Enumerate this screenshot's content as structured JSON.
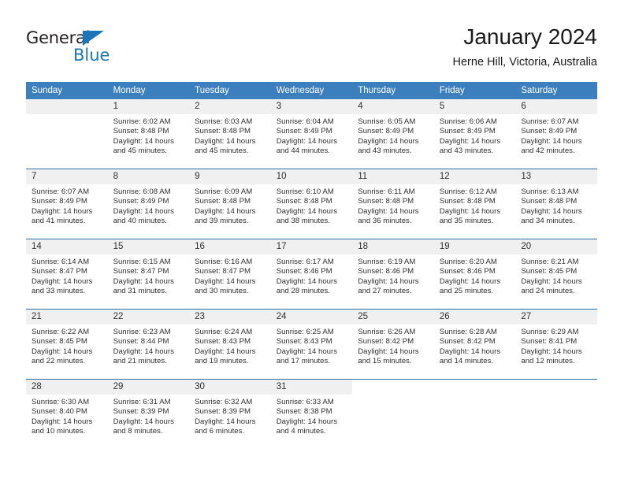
{
  "logo": {
    "word_one": "General",
    "word_two": "Blue",
    "triangle_color": "#1b75bb",
    "text_color": "#231f20"
  },
  "header": {
    "title": "January 2024",
    "subtitle": "Herne Hill, Victoria, Australia"
  },
  "theme": {
    "header_blue": "#3c7fbf",
    "row_border_blue": "#2e6da4",
    "daynum_background": "#f0f0f0",
    "text_color": "#303030"
  },
  "weekday_headers": [
    "Sunday",
    "Monday",
    "Tuesday",
    "Wednesday",
    "Thursday",
    "Friday",
    "Saturday"
  ],
  "weeks": [
    [
      {
        "day": "",
        "sunrise": "",
        "sunset": "",
        "daylight_line1": "",
        "daylight_line2": "",
        "blank": true
      },
      {
        "day": "1",
        "sunrise": "Sunrise: 6:02 AM",
        "sunset": "Sunset: 8:48 PM",
        "daylight_line1": "Daylight: 14 hours",
        "daylight_line2": "and 45 minutes."
      },
      {
        "day": "2",
        "sunrise": "Sunrise: 6:03 AM",
        "sunset": "Sunset: 8:48 PM",
        "daylight_line1": "Daylight: 14 hours",
        "daylight_line2": "and 45 minutes."
      },
      {
        "day": "3",
        "sunrise": "Sunrise: 6:04 AM",
        "sunset": "Sunset: 8:49 PM",
        "daylight_line1": "Daylight: 14 hours",
        "daylight_line2": "and 44 minutes."
      },
      {
        "day": "4",
        "sunrise": "Sunrise: 6:05 AM",
        "sunset": "Sunset: 8:49 PM",
        "daylight_line1": "Daylight: 14 hours",
        "daylight_line2": "and 43 minutes."
      },
      {
        "day": "5",
        "sunrise": "Sunrise: 6:06 AM",
        "sunset": "Sunset: 8:49 PM",
        "daylight_line1": "Daylight: 14 hours",
        "daylight_line2": "and 43 minutes."
      },
      {
        "day": "6",
        "sunrise": "Sunrise: 6:07 AM",
        "sunset": "Sunset: 8:49 PM",
        "daylight_line1": "Daylight: 14 hours",
        "daylight_line2": "and 42 minutes."
      }
    ],
    [
      {
        "day": "7",
        "sunrise": "Sunrise: 6:07 AM",
        "sunset": "Sunset: 8:49 PM",
        "daylight_line1": "Daylight: 14 hours",
        "daylight_line2": "and 41 minutes."
      },
      {
        "day": "8",
        "sunrise": "Sunrise: 6:08 AM",
        "sunset": "Sunset: 8:49 PM",
        "daylight_line1": "Daylight: 14 hours",
        "daylight_line2": "and 40 minutes."
      },
      {
        "day": "9",
        "sunrise": "Sunrise: 6:09 AM",
        "sunset": "Sunset: 8:48 PM",
        "daylight_line1": "Daylight: 14 hours",
        "daylight_line2": "and 39 minutes."
      },
      {
        "day": "10",
        "sunrise": "Sunrise: 6:10 AM",
        "sunset": "Sunset: 8:48 PM",
        "daylight_line1": "Daylight: 14 hours",
        "daylight_line2": "and 38 minutes."
      },
      {
        "day": "11",
        "sunrise": "Sunrise: 6:11 AM",
        "sunset": "Sunset: 8:48 PM",
        "daylight_line1": "Daylight: 14 hours",
        "daylight_line2": "and 36 minutes."
      },
      {
        "day": "12",
        "sunrise": "Sunrise: 6:12 AM",
        "sunset": "Sunset: 8:48 PM",
        "daylight_line1": "Daylight: 14 hours",
        "daylight_line2": "and 35 minutes."
      },
      {
        "day": "13",
        "sunrise": "Sunrise: 6:13 AM",
        "sunset": "Sunset: 8:48 PM",
        "daylight_line1": "Daylight: 14 hours",
        "daylight_line2": "and 34 minutes."
      }
    ],
    [
      {
        "day": "14",
        "sunrise": "Sunrise: 6:14 AM",
        "sunset": "Sunset: 8:47 PM",
        "daylight_line1": "Daylight: 14 hours",
        "daylight_line2": "and 33 minutes."
      },
      {
        "day": "15",
        "sunrise": "Sunrise: 6:15 AM",
        "sunset": "Sunset: 8:47 PM",
        "daylight_line1": "Daylight: 14 hours",
        "daylight_line2": "and 31 minutes."
      },
      {
        "day": "16",
        "sunrise": "Sunrise: 6:16 AM",
        "sunset": "Sunset: 8:47 PM",
        "daylight_line1": "Daylight: 14 hours",
        "daylight_line2": "and 30 minutes."
      },
      {
        "day": "17",
        "sunrise": "Sunrise: 6:17 AM",
        "sunset": "Sunset: 8:46 PM",
        "daylight_line1": "Daylight: 14 hours",
        "daylight_line2": "and 28 minutes."
      },
      {
        "day": "18",
        "sunrise": "Sunrise: 6:19 AM",
        "sunset": "Sunset: 8:46 PM",
        "daylight_line1": "Daylight: 14 hours",
        "daylight_line2": "and 27 minutes."
      },
      {
        "day": "19",
        "sunrise": "Sunrise: 6:20 AM",
        "sunset": "Sunset: 8:46 PM",
        "daylight_line1": "Daylight: 14 hours",
        "daylight_line2": "and 25 minutes."
      },
      {
        "day": "20",
        "sunrise": "Sunrise: 6:21 AM",
        "sunset": "Sunset: 8:45 PM",
        "daylight_line1": "Daylight: 14 hours",
        "daylight_line2": "and 24 minutes."
      }
    ],
    [
      {
        "day": "21",
        "sunrise": "Sunrise: 6:22 AM",
        "sunset": "Sunset: 8:45 PM",
        "daylight_line1": "Daylight: 14 hours",
        "daylight_line2": "and 22 minutes."
      },
      {
        "day": "22",
        "sunrise": "Sunrise: 6:23 AM",
        "sunset": "Sunset: 8:44 PM",
        "daylight_line1": "Daylight: 14 hours",
        "daylight_line2": "and 21 minutes."
      },
      {
        "day": "23",
        "sunrise": "Sunrise: 6:24 AM",
        "sunset": "Sunset: 8:43 PM",
        "daylight_line1": "Daylight: 14 hours",
        "daylight_line2": "and 19 minutes."
      },
      {
        "day": "24",
        "sunrise": "Sunrise: 6:25 AM",
        "sunset": "Sunset: 8:43 PM",
        "daylight_line1": "Daylight: 14 hours",
        "daylight_line2": "and 17 minutes."
      },
      {
        "day": "25",
        "sunrise": "Sunrise: 6:26 AM",
        "sunset": "Sunset: 8:42 PM",
        "daylight_line1": "Daylight: 14 hours",
        "daylight_line2": "and 15 minutes."
      },
      {
        "day": "26",
        "sunrise": "Sunrise: 6:28 AM",
        "sunset": "Sunset: 8:42 PM",
        "daylight_line1": "Daylight: 14 hours",
        "daylight_line2": "and 14 minutes."
      },
      {
        "day": "27",
        "sunrise": "Sunrise: 6:29 AM",
        "sunset": "Sunset: 8:41 PM",
        "daylight_line1": "Daylight: 14 hours",
        "daylight_line2": "and 12 minutes."
      }
    ],
    [
      {
        "day": "28",
        "sunrise": "Sunrise: 6:30 AM",
        "sunset": "Sunset: 8:40 PM",
        "daylight_line1": "Daylight: 14 hours",
        "daylight_line2": "and 10 minutes."
      },
      {
        "day": "29",
        "sunrise": "Sunrise: 6:31 AM",
        "sunset": "Sunset: 8:39 PM",
        "daylight_line1": "Daylight: 14 hours",
        "daylight_line2": "and 8 minutes."
      },
      {
        "day": "30",
        "sunrise": "Sunrise: 6:32 AM",
        "sunset": "Sunset: 8:39 PM",
        "daylight_line1": "Daylight: 14 hours",
        "daylight_line2": "and 6 minutes."
      },
      {
        "day": "31",
        "sunrise": "Sunrise: 6:33 AM",
        "sunset": "Sunset: 8:38 PM",
        "daylight_line1": "Daylight: 14 hours",
        "daylight_line2": "and 4 minutes."
      },
      {
        "day": "",
        "sunrise": "",
        "sunset": "",
        "daylight_line1": "",
        "daylight_line2": "",
        "blank_end": true
      },
      {
        "day": "",
        "sunrise": "",
        "sunset": "",
        "daylight_line1": "",
        "daylight_line2": "",
        "blank_end": true
      },
      {
        "day": "",
        "sunrise": "",
        "sunset": "",
        "daylight_line1": "",
        "daylight_line2": "",
        "blank_end": true
      }
    ]
  ]
}
